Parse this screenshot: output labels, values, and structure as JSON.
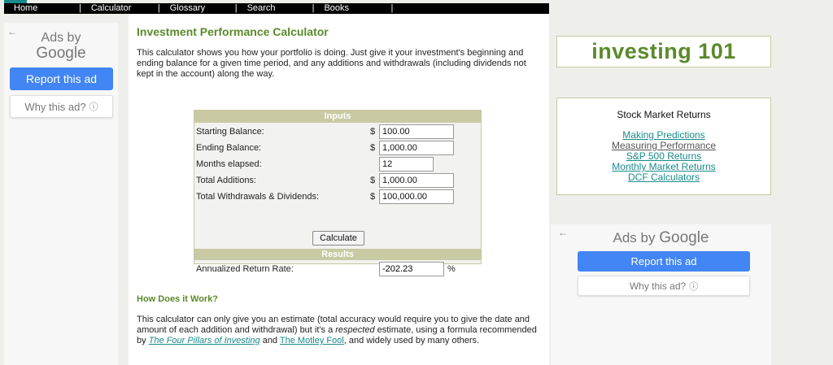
{
  "nav": {
    "items": [
      "Home",
      "Calculator",
      "Glossary",
      "Search",
      "Books"
    ]
  },
  "left_ad": {
    "ads_by": "Ads by",
    "google": "Google",
    "report": "Report this ad",
    "why": "Why this ad?"
  },
  "main": {
    "title": "Investment Performance Calculator",
    "intro": "This calculator shows you how your portfolio is doing. Just give it your investment's beginning and ending balance for a given time period, and any additions and withdrawals (including dividends not kept in the account) along the way.",
    "inputs_header": "Inputs",
    "fields": {
      "starting_label": "Starting Balance:",
      "starting_value": "100.00",
      "ending_label": "Ending Balance:",
      "ending_value": "1,000.00",
      "months_label": "Months elapsed:",
      "months_value": "12",
      "additions_label": "Total Additions:",
      "additions_value": "1,000.00",
      "withdrawals_label": "Total Withdrawals & Dividends:",
      "withdrawals_value": "100,000.00",
      "currency": "$"
    },
    "calculate_label": "Calculate",
    "results_header": "Results",
    "result_label": "Annualized Return Rate:",
    "result_value": "-202.23",
    "result_unit": "%",
    "how_title": "How Does it Work?",
    "how_text_1": "This calculator can only give you an estimate (total accuracy would require you to give the date and amount of each addition and withdrawal) but it's a ",
    "how_text_em": "respected",
    "how_text_2": " estimate, using a formula recommended by ",
    "link_four_pillars": "The Four Pillars of Investing",
    "how_text_and": " and ",
    "link_motley": "The Motley Fool",
    "how_text_3": ", and widely used by many others."
  },
  "right": {
    "brand": "investing 101",
    "smr_title": "Stock Market Returns",
    "links": [
      "Making Predictions",
      "Measuring Performance",
      "S&P 500 Returns",
      "Monthly Market Returns",
      "DCF Calculators"
    ]
  },
  "right_ad": {
    "ads_by": "Ads by",
    "google": "Google",
    "report": "Report this ad",
    "why": "Why this ad?"
  },
  "colors": {
    "accent_green": "#5a8a2a",
    "header_tan": "#c9c9a3",
    "link_teal": "#1a8a8a",
    "google_blue": "#4285f4"
  }
}
